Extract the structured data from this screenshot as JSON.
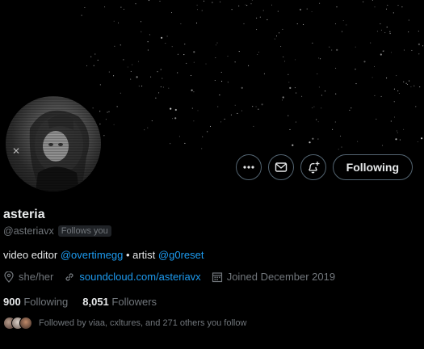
{
  "profile": {
    "display_name": "asteria",
    "handle": "@asteriavx",
    "follows_you_badge": "Follows you",
    "bio": {
      "text1": "video editor ",
      "mention1": "@overtimegg",
      "text2": " • artist ",
      "mention2": "@g0reset"
    },
    "pronouns": "she/her",
    "website": "soundcloud.com/asteriavx",
    "joined": "Joined December 2019"
  },
  "actions": {
    "following_label": "Following"
  },
  "stats": {
    "following_count": "900",
    "following_label": "Following",
    "followers_count": "8,051",
    "followers_label": "Followers"
  },
  "followed_by": {
    "text": "Followed by viaa, cxltures, and 271 others you follow"
  },
  "icons": {
    "more": "more-icon",
    "message": "envelope-icon",
    "notify": "bell-plus-icon",
    "location": "location-pin-icon",
    "link": "link-icon",
    "calendar": "calendar-icon"
  },
  "colors": {
    "background": "#000000",
    "text_primary": "#e7e9ea",
    "text_secondary": "#71767b",
    "link": "#1d9bf0",
    "border": "#536471"
  }
}
